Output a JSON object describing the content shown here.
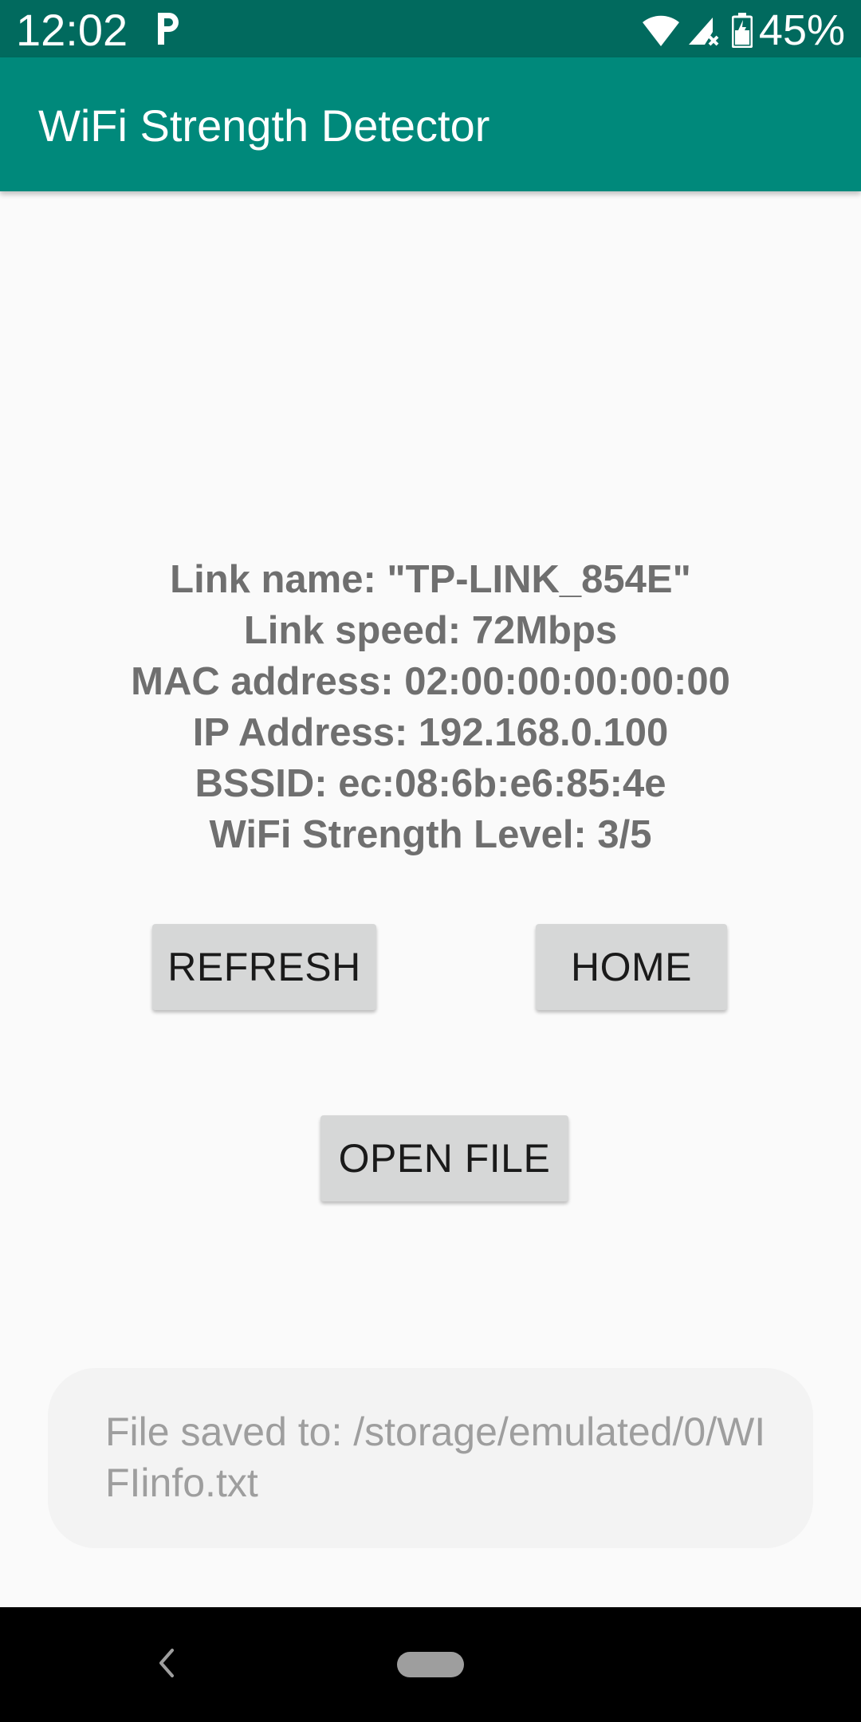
{
  "status_bar": {
    "time": "12:02",
    "battery_percent": "45%",
    "icons": [
      "parking-icon",
      "wifi-icon",
      "signal-icon",
      "battery-icon"
    ]
  },
  "app_bar": {
    "title": "WiFi Strength Detector",
    "color": "#00897b"
  },
  "info": {
    "link_name": "Link name: \"TP-LINK_854E\"",
    "link_speed": "Link speed: 72Mbps",
    "mac_address": "MAC address: 02:00:00:00:00:00",
    "ip_address": "IP Address: 192.168.0.100",
    "bssid": "BSSID: ec:08:6b:e6:85:4e",
    "strength_level": "WiFi Strength Level: 3/5"
  },
  "buttons": {
    "refresh": "REFRESH",
    "home": "HOME",
    "open_file": "OPEN FILE"
  },
  "toast": {
    "message": "File saved to: /storage/emulated/0/WIFIinfo.txt"
  },
  "nav_bar": {
    "icons": [
      "back-icon",
      "home-pill-icon"
    ]
  }
}
